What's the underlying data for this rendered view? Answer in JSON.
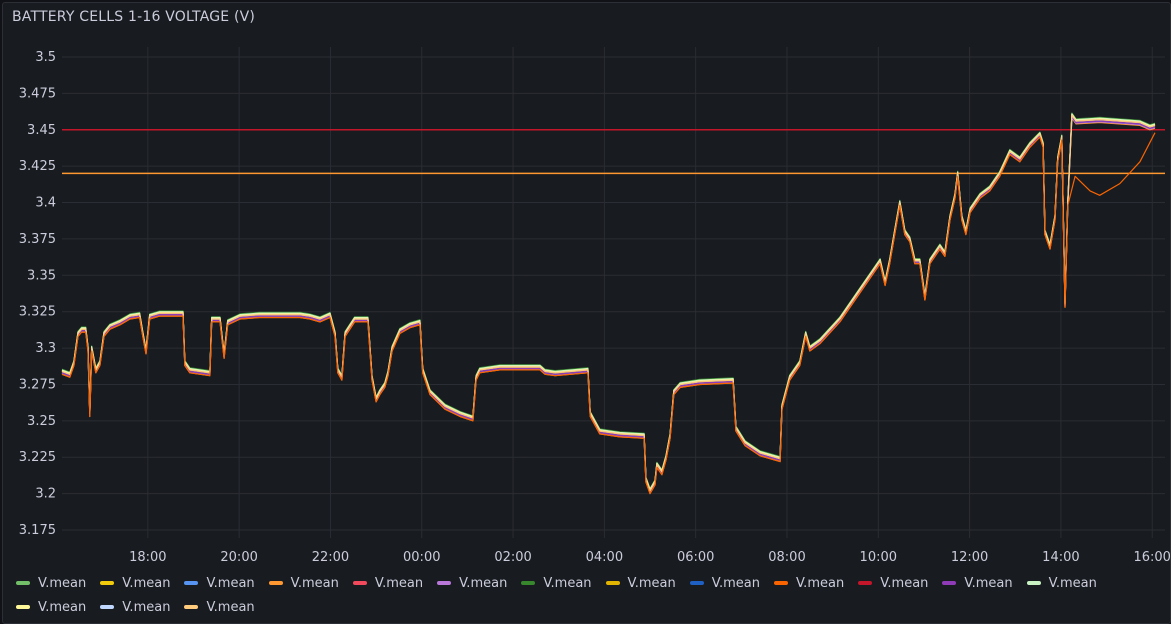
{
  "panel": {
    "title": "BATTERY CELLS 1-16 VOLTAGE (V)"
  },
  "chart_data": {
    "type": "line",
    "title": "BATTERY CELLS 1-16 VOLTAGE (V)",
    "xlabel": "",
    "ylabel": "",
    "x_units": "hours since 16:00 (day 1)",
    "xlim": [
      0.12,
      24.28
    ],
    "ylim": [
      3.175,
      3.5
    ],
    "grid": true,
    "legend_placement": "bottom",
    "y_ticks": [
      "3.175",
      "3.2",
      "3.225",
      "3.25",
      "3.275",
      "3.3",
      "3.325",
      "3.35",
      "3.375",
      "3.4",
      "3.425",
      "3.45",
      "3.475",
      "3.5"
    ],
    "x_ticks": [
      {
        "x": 2,
        "label": "18:00"
      },
      {
        "x": 4,
        "label": "20:00"
      },
      {
        "x": 6,
        "label": "22:00"
      },
      {
        "x": 8,
        "label": "00:00"
      },
      {
        "x": 10,
        "label": "02:00"
      },
      {
        "x": 12,
        "label": "04:00"
      },
      {
        "x": 14,
        "label": "06:00"
      },
      {
        "x": 16,
        "label": "08:00"
      },
      {
        "x": 18,
        "label": "10:00"
      },
      {
        "x": 20,
        "label": "12:00"
      },
      {
        "x": 22,
        "label": "14:00"
      },
      {
        "x": 24,
        "label": "16:00"
      }
    ],
    "thresholds": [
      {
        "value": 3.45,
        "color": "#C4162A"
      },
      {
        "value": 3.42,
        "color": "#FF9830"
      }
    ],
    "base_series": [
      [
        0.12,
        3.284
      ],
      [
        0.29,
        3.282
      ],
      [
        0.38,
        3.29
      ],
      [
        0.47,
        3.31
      ],
      [
        0.55,
        3.313
      ],
      [
        0.64,
        3.313
      ],
      [
        0.69,
        3.3
      ],
      [
        0.73,
        3.255
      ],
      [
        0.77,
        3.3
      ],
      [
        0.86,
        3.285
      ],
      [
        0.95,
        3.29
      ],
      [
        1.04,
        3.31
      ],
      [
        1.17,
        3.315
      ],
      [
        1.39,
        3.318
      ],
      [
        1.61,
        3.322
      ],
      [
        1.82,
        3.323
      ],
      [
        1.89,
        3.31
      ],
      [
        1.96,
        3.298
      ],
      [
        2.04,
        3.322
      ],
      [
        2.26,
        3.324
      ],
      [
        2.77,
        3.324
      ],
      [
        2.81,
        3.29
      ],
      [
        2.92,
        3.285
      ],
      [
        3.36,
        3.283
      ],
      [
        3.4,
        3.32
      ],
      [
        3.58,
        3.32
      ],
      [
        3.67,
        3.295
      ],
      [
        3.75,
        3.318
      ],
      [
        4.02,
        3.322
      ],
      [
        4.45,
        3.323
      ],
      [
        5.33,
        3.323
      ],
      [
        5.55,
        3.322
      ],
      [
        5.77,
        3.32
      ],
      [
        5.99,
        3.323
      ],
      [
        6.1,
        3.31
      ],
      [
        6.16,
        3.285
      ],
      [
        6.25,
        3.28
      ],
      [
        6.32,
        3.31
      ],
      [
        6.53,
        3.32
      ],
      [
        6.82,
        3.32
      ],
      [
        6.91,
        3.28
      ],
      [
        7.0,
        3.265
      ],
      [
        7.08,
        3.27
      ],
      [
        7.19,
        3.275
      ],
      [
        7.26,
        3.283
      ],
      [
        7.35,
        3.3
      ],
      [
        7.52,
        3.312
      ],
      [
        7.74,
        3.316
      ],
      [
        7.96,
        3.318
      ],
      [
        8.02,
        3.285
      ],
      [
        8.18,
        3.27
      ],
      [
        8.51,
        3.26
      ],
      [
        8.84,
        3.255
      ],
      [
        9.12,
        3.252
      ],
      [
        9.19,
        3.28
      ],
      [
        9.27,
        3.285
      ],
      [
        9.71,
        3.287
      ],
      [
        10.59,
        3.287
      ],
      [
        10.7,
        3.284
      ],
      [
        10.92,
        3.283
      ],
      [
        11.64,
        3.285
      ],
      [
        11.69,
        3.255
      ],
      [
        11.9,
        3.243
      ],
      [
        12.34,
        3.241
      ],
      [
        12.87,
        3.24
      ],
      [
        12.91,
        3.21
      ],
      [
        13.0,
        3.202
      ],
      [
        13.11,
        3.208
      ],
      [
        13.15,
        3.22
      ],
      [
        13.26,
        3.215
      ],
      [
        13.35,
        3.225
      ],
      [
        13.44,
        3.24
      ],
      [
        13.52,
        3.27
      ],
      [
        13.66,
        3.275
      ],
      [
        14.09,
        3.277
      ],
      [
        14.82,
        3.278
      ],
      [
        14.88,
        3.245
      ],
      [
        15.08,
        3.235
      ],
      [
        15.41,
        3.228
      ],
      [
        15.85,
        3.224
      ],
      [
        15.89,
        3.26
      ],
      [
        16.06,
        3.28
      ],
      [
        16.28,
        3.29
      ],
      [
        16.41,
        3.31
      ],
      [
        16.5,
        3.3
      ],
      [
        16.72,
        3.305
      ],
      [
        17.16,
        3.32
      ],
      [
        17.6,
        3.34
      ],
      [
        18.04,
        3.36
      ],
      [
        18.15,
        3.345
      ],
      [
        18.25,
        3.36
      ],
      [
        18.36,
        3.38
      ],
      [
        18.47,
        3.4
      ],
      [
        18.58,
        3.38
      ],
      [
        18.69,
        3.375
      ],
      [
        18.8,
        3.36
      ],
      [
        18.91,
        3.36
      ],
      [
        19.02,
        3.335
      ],
      [
        19.13,
        3.36
      ],
      [
        19.35,
        3.37
      ],
      [
        19.46,
        3.365
      ],
      [
        19.57,
        3.39
      ],
      [
        19.68,
        3.405
      ],
      [
        19.74,
        3.42
      ],
      [
        19.83,
        3.39
      ],
      [
        19.92,
        3.38
      ],
      [
        20.01,
        3.395
      ],
      [
        20.23,
        3.405
      ],
      [
        20.44,
        3.41
      ],
      [
        20.66,
        3.42
      ],
      [
        20.88,
        3.435
      ],
      [
        21.1,
        3.43
      ],
      [
        21.32,
        3.44
      ],
      [
        21.54,
        3.447
      ],
      [
        21.61,
        3.44
      ],
      [
        21.65,
        3.38
      ],
      [
        21.76,
        3.37
      ],
      [
        21.87,
        3.39
      ],
      [
        21.93,
        3.43
      ],
      [
        22.02,
        3.445
      ],
      [
        22.09,
        3.33
      ],
      [
        22.15,
        3.4
      ],
      [
        22.24,
        3.46
      ],
      [
        22.33,
        3.456
      ],
      [
        22.85,
        3.457
      ],
      [
        23.73,
        3.455
      ],
      [
        23.95,
        3.452
      ],
      [
        24.06,
        3.453
      ]
    ],
    "alt_tail_after": 22.15,
    "alt_tail": [
      [
        22.31,
        3.42
      ],
      [
        22.64,
        3.41
      ],
      [
        22.85,
        3.407
      ],
      [
        23.29,
        3.415
      ],
      [
        23.73,
        3.43
      ],
      [
        24.06,
        3.45
      ]
    ],
    "series": [
      {
        "name": "V.mean",
        "color": "#73BF69",
        "offset": 0.001
      },
      {
        "name": "V.mean",
        "color": "#F2CC0C",
        "offset": 0.0
      },
      {
        "name": "V.mean",
        "color": "#5794F2",
        "offset": -0.001
      },
      {
        "name": "V.mean",
        "color": "#FF9830",
        "offset": -0.002
      },
      {
        "name": "V.mean",
        "color": "#F2495C",
        "offset": 0.0005
      },
      {
        "name": "V.mean",
        "color": "#B877D9",
        "offset": -0.0015
      },
      {
        "name": "V.mean",
        "color": "#37872D",
        "offset": 0.0015
      },
      {
        "name": "V.mean",
        "color": "#E0B400",
        "offset": -0.0005
      },
      {
        "name": "V.mean",
        "color": "#1F60C4",
        "offset": -0.001
      },
      {
        "name": "V.mean",
        "color": "#FA6400",
        "offset": -0.002,
        "alt_tail": true
      },
      {
        "name": "V.mean",
        "color": "#C4162A",
        "offset": 0.0
      },
      {
        "name": "V.mean",
        "color": "#8F3BB8",
        "offset": -0.001
      },
      {
        "name": "V.mean",
        "color": "#C8F2C2",
        "offset": 0.001
      },
      {
        "name": "V.mean",
        "color": "#FFF899",
        "offset": 0.0005
      },
      {
        "name": "V.mean",
        "color": "#C0D8FF",
        "offset": 0.0
      },
      {
        "name": "V.mean",
        "color": "#FFCB7D",
        "offset": 0.0
      }
    ]
  }
}
